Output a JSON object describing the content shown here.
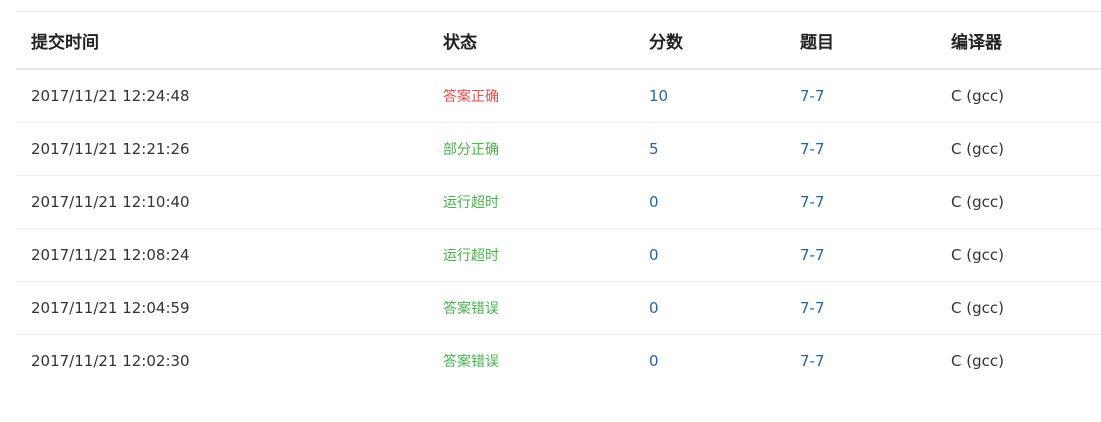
{
  "headers": {
    "time": "提交时间",
    "status": "状态",
    "score": "分数",
    "problem": "题目",
    "compiler": "编译器"
  },
  "rows": [
    {
      "time": "2017/11/21 12:24:48",
      "status": "答案正确",
      "score": "10",
      "problem": "7-7",
      "compiler": "C (gcc)"
    },
    {
      "time": "2017/11/21 12:21:26",
      "status": "部分正确",
      "score": "5",
      "problem": "7-7",
      "compiler": "C (gcc)"
    },
    {
      "time": "2017/11/21 12:10:40",
      "status": "运行超时",
      "score": "0",
      "problem": "7-7",
      "compiler": "C (gcc)"
    },
    {
      "time": "2017/11/21 12:08:24",
      "status": "运行超时",
      "score": "0",
      "problem": "7-7",
      "compiler": "C (gcc)"
    },
    {
      "time": "2017/11/21 12:04:59",
      "status": "答案错误",
      "score": "0",
      "problem": "7-7",
      "compiler": "C (gcc)"
    },
    {
      "time": "2017/11/21 12:02:30",
      "status": "答案错误",
      "score": "0",
      "problem": "7-7",
      "compiler": "C (gcc)"
    }
  ],
  "colors": {
    "accepted": "#e04e4e",
    "other_status": "#4caf50",
    "link": "#2a6496"
  }
}
